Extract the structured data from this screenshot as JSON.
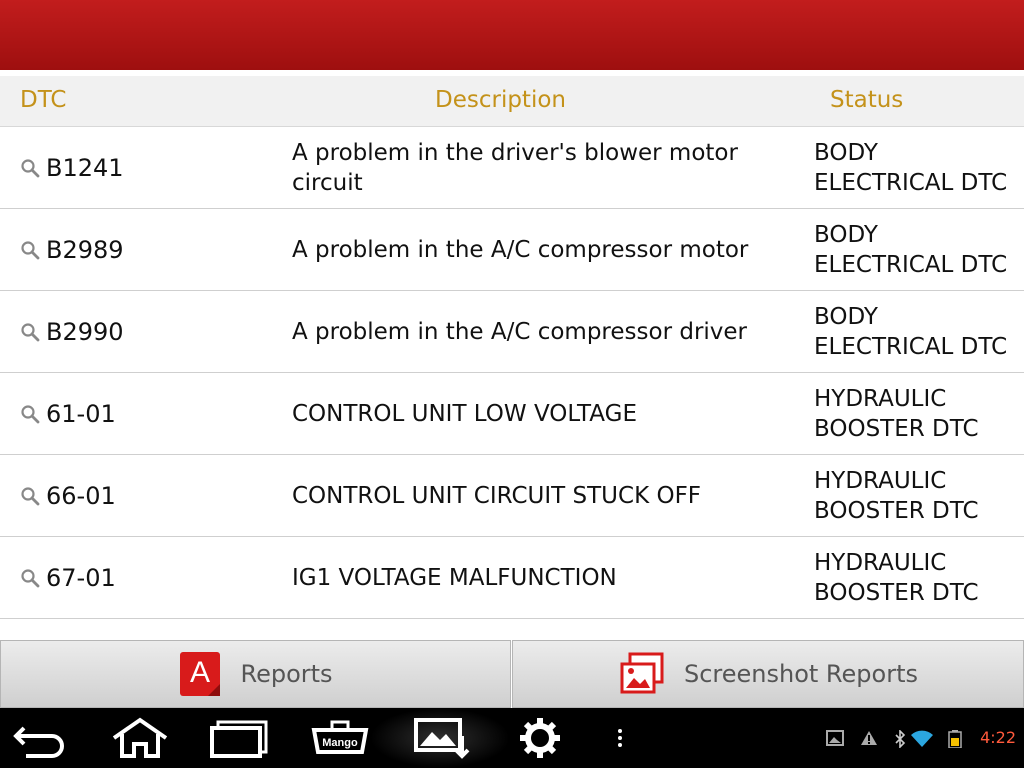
{
  "header": {
    "dtc": "DTC",
    "description": "Description",
    "status": "Status"
  },
  "rows": [
    {
      "code": "B1241",
      "description": "A problem in the driver's blower motor circuit",
      "status": "BODY ELECTRICAL DTC"
    },
    {
      "code": "B2989",
      "description": "A problem in the A/C compressor motor",
      "status": "BODY ELECTRICAL DTC"
    },
    {
      "code": "B2990",
      "description": "A problem in the A/C compressor driver",
      "status": "BODY ELECTRICAL DTC"
    },
    {
      "code": "61-01",
      "description": "CONTROL UNIT LOW VOLTAGE",
      "status": "HYDRAULIC BOOSTER DTC"
    },
    {
      "code": "66-01",
      "description": "CONTROL UNIT CIRCUIT STUCK OFF",
      "status": "HYDRAULIC BOOSTER DTC"
    },
    {
      "code": "67-01",
      "description": "IG1 VOLTAGE MALFUNCTION",
      "status": "HYDRAULIC BOOSTER DTC"
    }
  ],
  "buttons": {
    "reports": "Reports",
    "reports_icon_letter": "A",
    "screenshot_reports": "Screenshot Reports"
  },
  "navbar": {
    "obd_label": "Mango"
  },
  "status_bar": {
    "time": "4:22"
  },
  "colors": {
    "header_text": "#c4921a",
    "topbar": "#b21616",
    "clock": "#ff5a3c"
  }
}
